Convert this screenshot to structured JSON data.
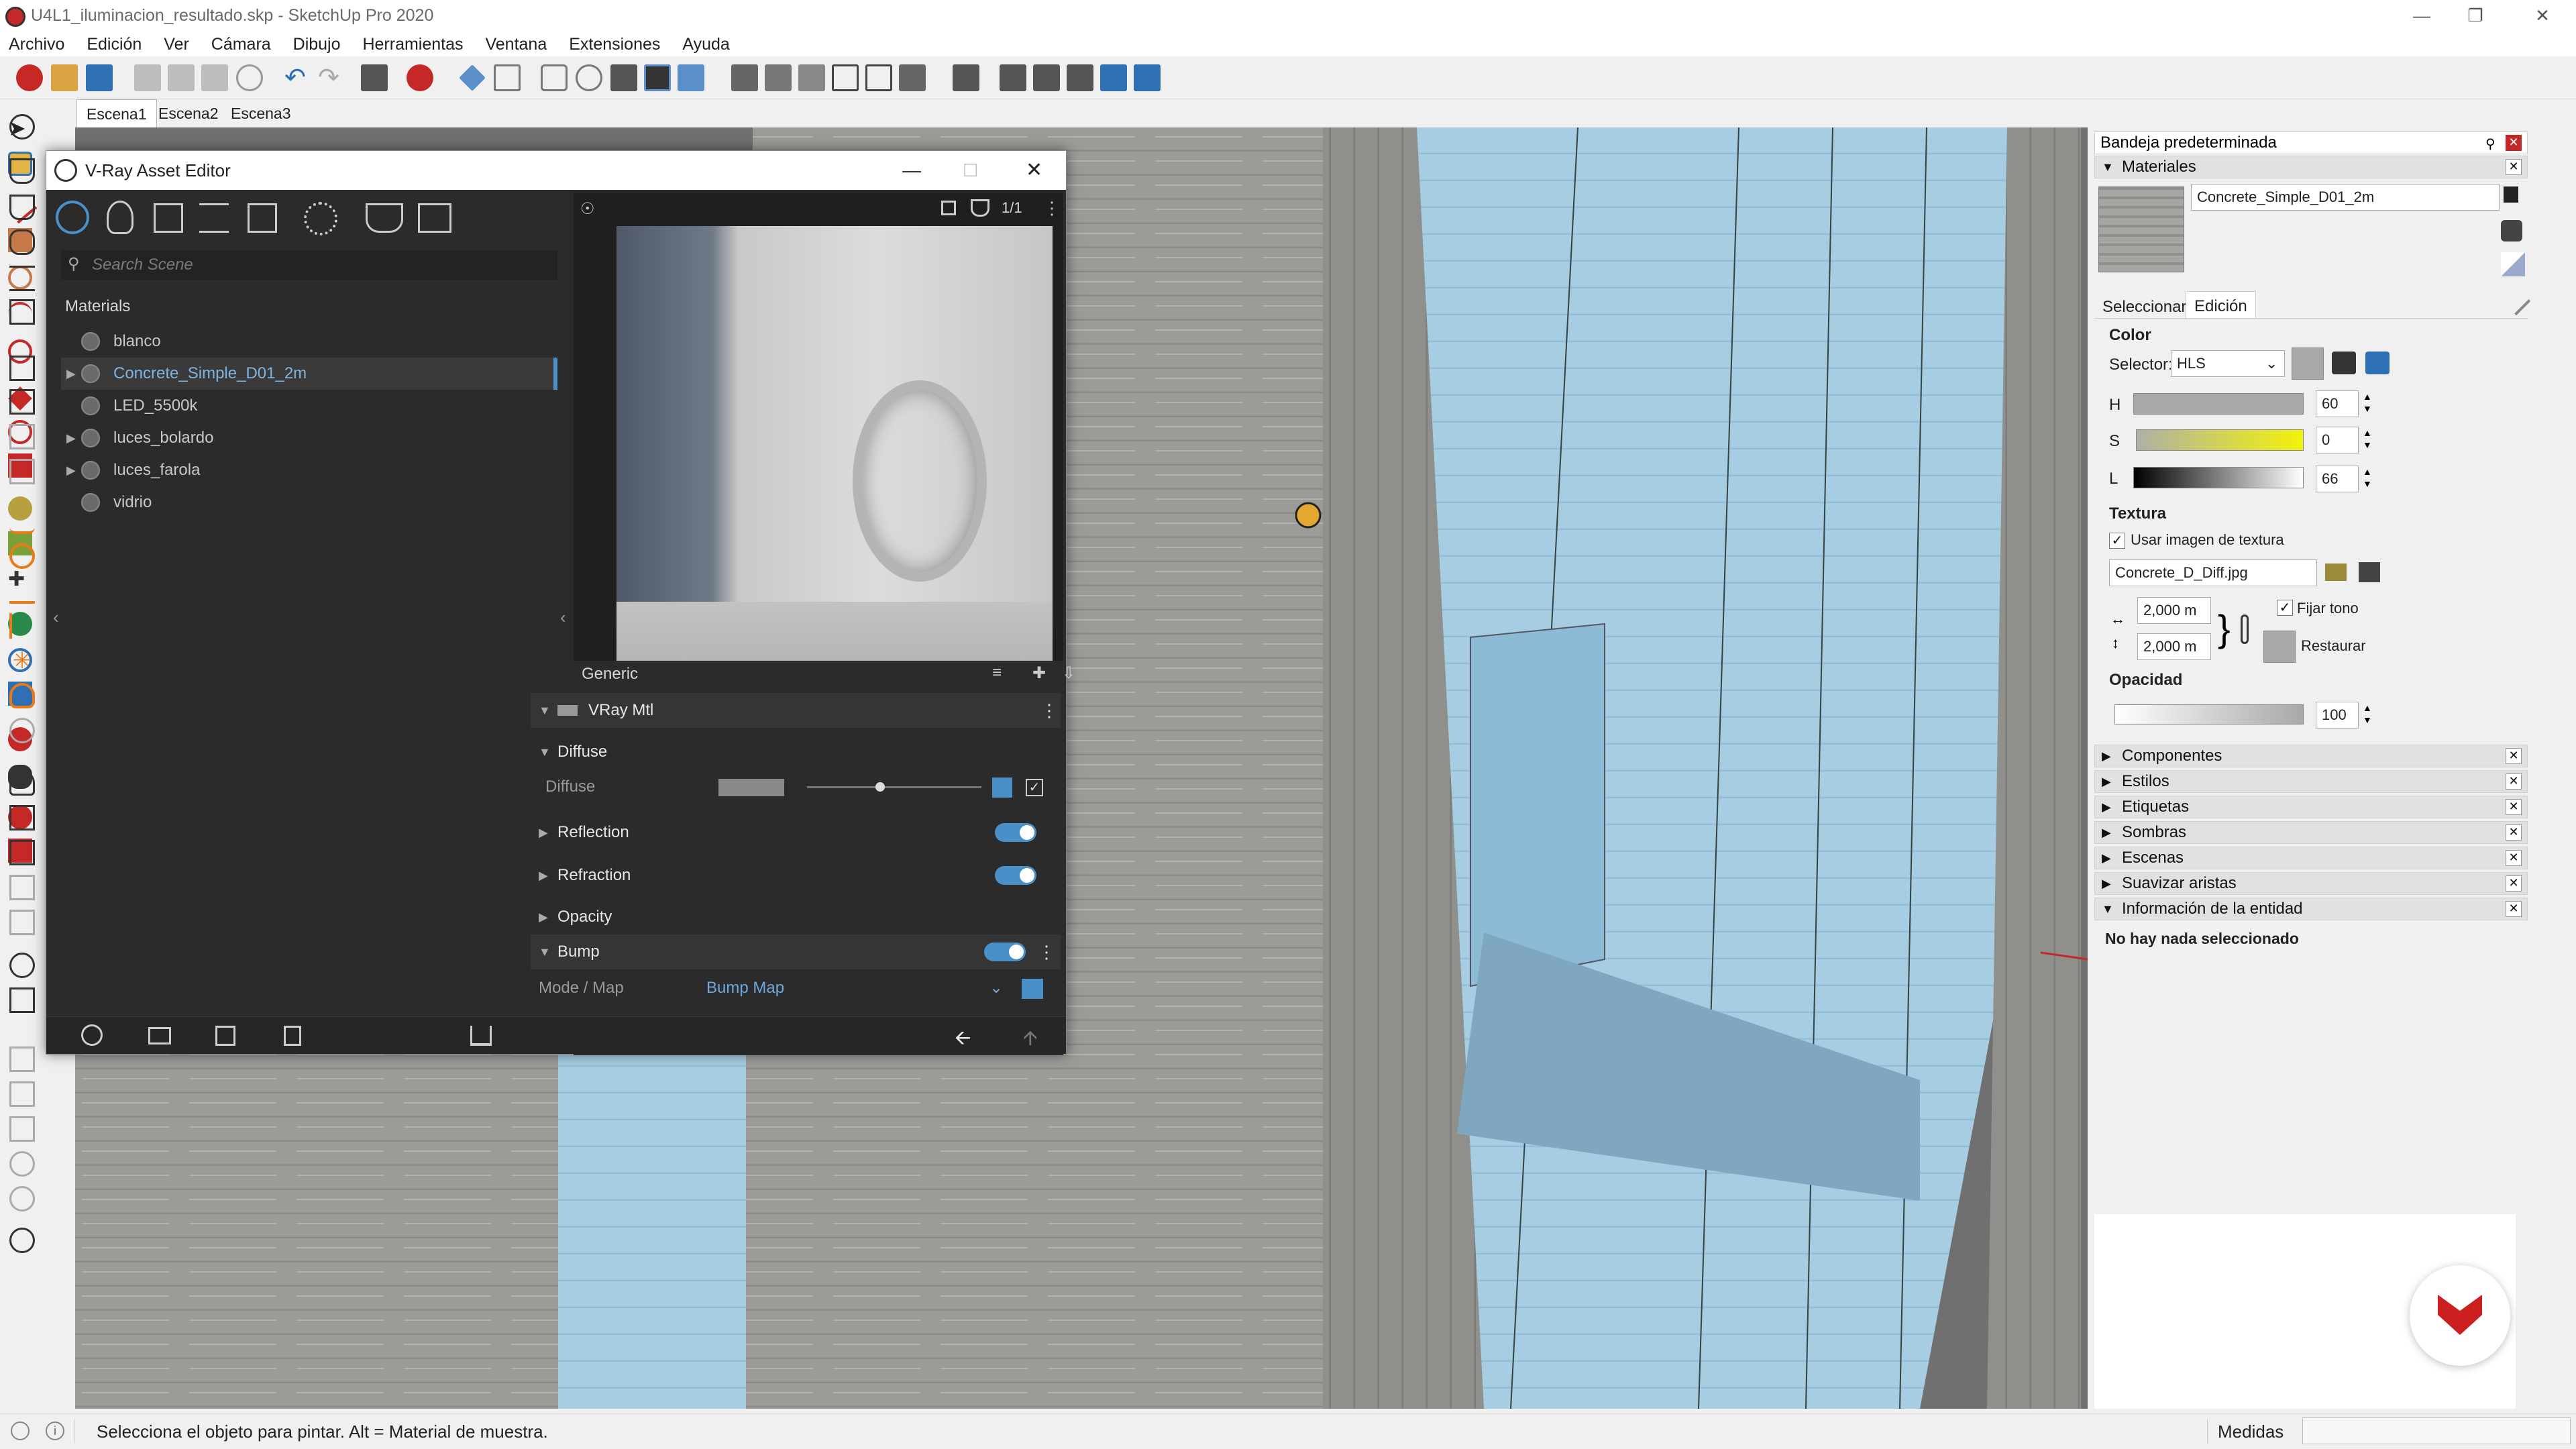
{
  "window": {
    "title": "U4L1_iluminacion_resultado.skp - SketchUp Pro 2020"
  },
  "menu": [
    "Archivo",
    "Edición",
    "Ver",
    "Cámara",
    "Dibujo",
    "Herramientas",
    "Ventana",
    "Extensiones",
    "Ayuda"
  ],
  "scenes": [
    "Escena1",
    "Escena2",
    "Escena3"
  ],
  "vray": {
    "title": "V-Ray Asset Editor",
    "search_placeholder": "Search Scene",
    "materials_header": "Materials",
    "materials": [
      "blanco",
      "Concrete_Simple_D01_2m",
      "LED_5500k",
      "luces_bolardo",
      "luces_farola",
      "vidrio"
    ],
    "render_counter": "1/1",
    "generic_label": "Generic",
    "material_type": "VRay Mtl",
    "diffuse_section": "Diffuse",
    "diffuse_param": "Diffuse",
    "reflection": "Reflection",
    "refraction": "Refraction",
    "opacity": "Opacity",
    "bump": "Bump",
    "mode_map_label": "Mode / Map",
    "mode_map_value": "Bump Map"
  },
  "tray": {
    "title": "Bandeja predeterminada",
    "materials_panel": "Materiales",
    "material_name": "Concrete_Simple_D01_2m",
    "tab_select": "Seleccionar",
    "tab_edit": "Edición",
    "color_label": "Color",
    "selector_label": "Selector:",
    "selector_value": "HLS",
    "h_label": "H",
    "h_value": "60",
    "s_label": "S",
    "s_value": "0",
    "l_label": "L",
    "l_value": "66",
    "texture_label": "Textura",
    "use_texture": "Usar imagen de textura",
    "texture_file": "Concrete_D_Diff.jpg",
    "width": "2,000 m",
    "height": "2,000 m",
    "fix_tone": "Fijar tono",
    "restore": "Restaurar",
    "opacity_label": "Opacidad",
    "opacity_value": "100",
    "panels": [
      "Componentes",
      "Estilos",
      "Etiquetas",
      "Sombras",
      "Escenas",
      "Suavizar aristas",
      "Información de la entidad"
    ],
    "entity_info": "No hay nada seleccionado"
  },
  "status": {
    "message": "Selecciona el objeto para pintar. Alt = Material de muestra.",
    "measures_label": "Medidas"
  },
  "colors": {
    "accent": "#4a90c8",
    "concrete": "#9a9a98",
    "glass": "#9cc7df",
    "brand_red": "#cc1f1f"
  }
}
